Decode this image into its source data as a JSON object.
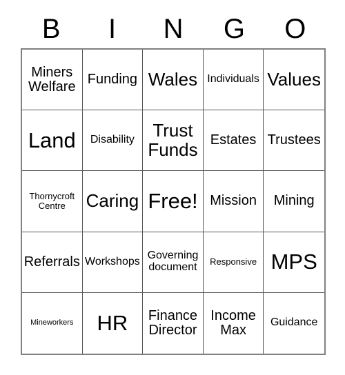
{
  "card": {
    "title": "BINGO",
    "header_letters": [
      "B",
      "I",
      "N",
      "G",
      "O"
    ],
    "border_color": "#808080",
    "grid_line_color": "#555555",
    "background_color": "#ffffff",
    "text_color": "#000000",
    "rows": 5,
    "columns": 5,
    "free_space_label": "Free!",
    "cells": [
      {
        "text": "Miners Welfare",
        "size": "md",
        "free": false
      },
      {
        "text": "Funding",
        "size": "md",
        "free": false
      },
      {
        "text": "Wales",
        "size": "lg",
        "free": false
      },
      {
        "text": "Individuals",
        "size": "sm",
        "free": false
      },
      {
        "text": "Values",
        "size": "lg",
        "free": false
      },
      {
        "text": "Land",
        "size": "xl",
        "free": false
      },
      {
        "text": "Disability",
        "size": "sm",
        "free": false
      },
      {
        "text": "Trust Funds",
        "size": "lg",
        "free": false
      },
      {
        "text": "Estates",
        "size": "md",
        "free": false
      },
      {
        "text": "Trustees",
        "size": "md",
        "free": false
      },
      {
        "text": "Thornycroft Centre",
        "size": "xs",
        "free": false
      },
      {
        "text": "Caring",
        "size": "lg",
        "free": false
      },
      {
        "text": "Free!",
        "size": "xl",
        "free": true
      },
      {
        "text": "Mission",
        "size": "md",
        "free": false
      },
      {
        "text": "Mining",
        "size": "md",
        "free": false
      },
      {
        "text": "Referrals",
        "size": "md",
        "free": false
      },
      {
        "text": "Workshops",
        "size": "sm",
        "free": false
      },
      {
        "text": "Governing document",
        "size": "sm",
        "free": false
      },
      {
        "text": "Responsive",
        "size": "xs",
        "free": false
      },
      {
        "text": "MPS",
        "size": "xl",
        "free": false
      },
      {
        "text": "Mineworkers",
        "size": "xxs",
        "free": false
      },
      {
        "text": "HR",
        "size": "xl",
        "free": false
      },
      {
        "text": "Finance Director",
        "size": "md",
        "free": false
      },
      {
        "text": "Income Max",
        "size": "md",
        "free": false
      },
      {
        "text": "Guidance",
        "size": "sm",
        "free": false
      }
    ]
  }
}
